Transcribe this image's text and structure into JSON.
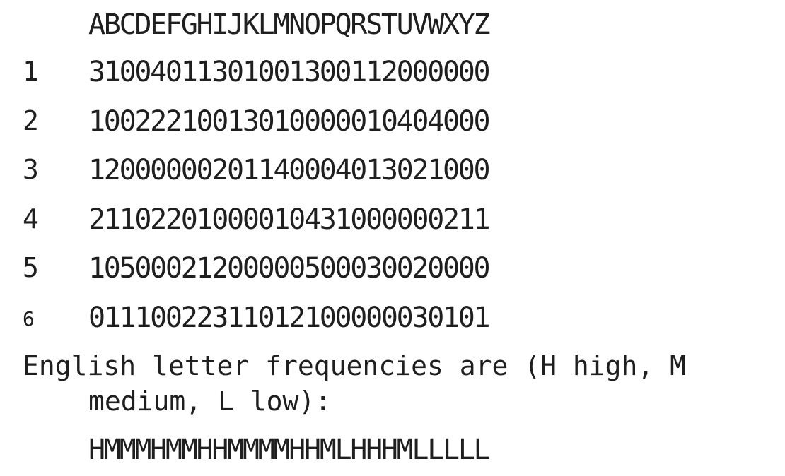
{
  "header": {
    "alphabet": "ABCDEFGHIJKLMNOPQRSTUVWXYZ"
  },
  "rows": [
    {
      "label": "1",
      "digits": "31004011301001300112000000"
    },
    {
      "label": "2",
      "digits": "10022210013010000010404000"
    },
    {
      "label": "3",
      "digits": "12000000201140004013021000"
    },
    {
      "label": "4",
      "digits": "21102201000010431000000211"
    },
    {
      "label": "5",
      "digits": "10500021200000500030020000"
    },
    {
      "label": "6",
      "digits": "01110022311012100000030101"
    }
  ],
  "note": {
    "line1": "English letter frequencies are (H high, M",
    "line2": "medium, L low):"
  },
  "frequencies": "HMMMHMMHHMMMMHHMLHHHMLLLLL"
}
